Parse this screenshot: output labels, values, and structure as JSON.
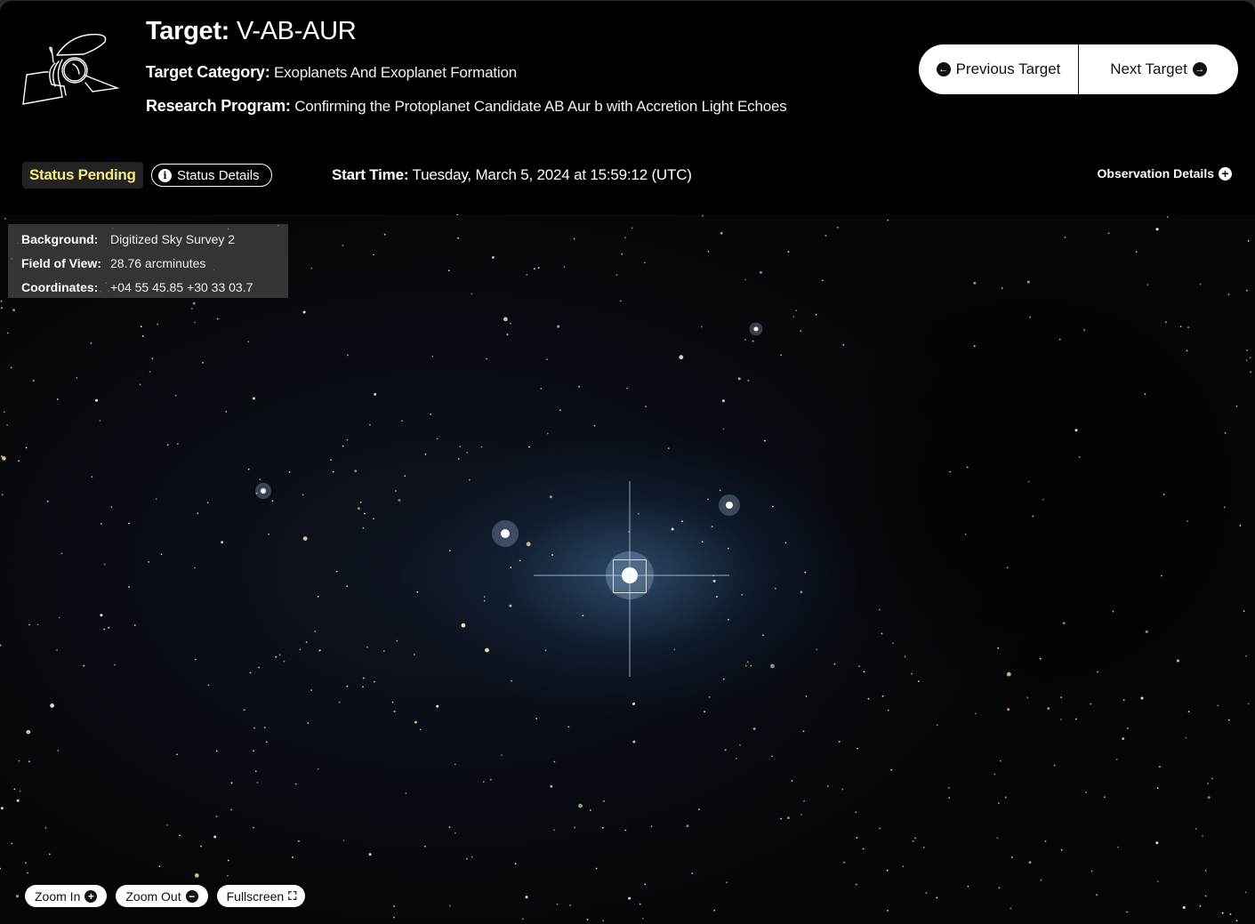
{
  "header": {
    "title_label": "Target:",
    "title_value": "V-AB-AUR",
    "category_label": "Target Category:",
    "category_value": "Exoplanets And Exoplanet Formation",
    "program_label": "Research Program:",
    "program_value": "Confirming the Protoplanet Candidate AB Aur b with Accretion Light Echoes",
    "logo_icon": "telescope-icon"
  },
  "nav": {
    "previous_label": "Previous Target",
    "previous_icon": "arrow-left-circle-icon",
    "next_label": "Next Target",
    "next_icon": "arrow-right-circle-icon"
  },
  "status": {
    "badge_label": "Status Pending",
    "badge_color": "#f5e97a",
    "details_label": "Status Details",
    "details_icon": "info-icon"
  },
  "start_time": {
    "label": "Start Time:",
    "value": "Tuesday, March 5, 2024 at 15:59:12 (UTC)"
  },
  "observation_details": {
    "label": "Observation Details",
    "icon": "plus-circle-icon"
  },
  "image_info": {
    "rows": [
      {
        "label": "Background:",
        "value": "Digitized Sky Survey 2"
      },
      {
        "label": "Field of View:",
        "value": "28.76 arcminutes"
      },
      {
        "label": "Coordinates:",
        "value": "+04 55 45.85 +30 33 03.7"
      }
    ]
  },
  "controls": {
    "zoom_in_label": "Zoom In",
    "zoom_out_label": "Zoom Out",
    "fullscreen_label": "Fullscreen"
  }
}
